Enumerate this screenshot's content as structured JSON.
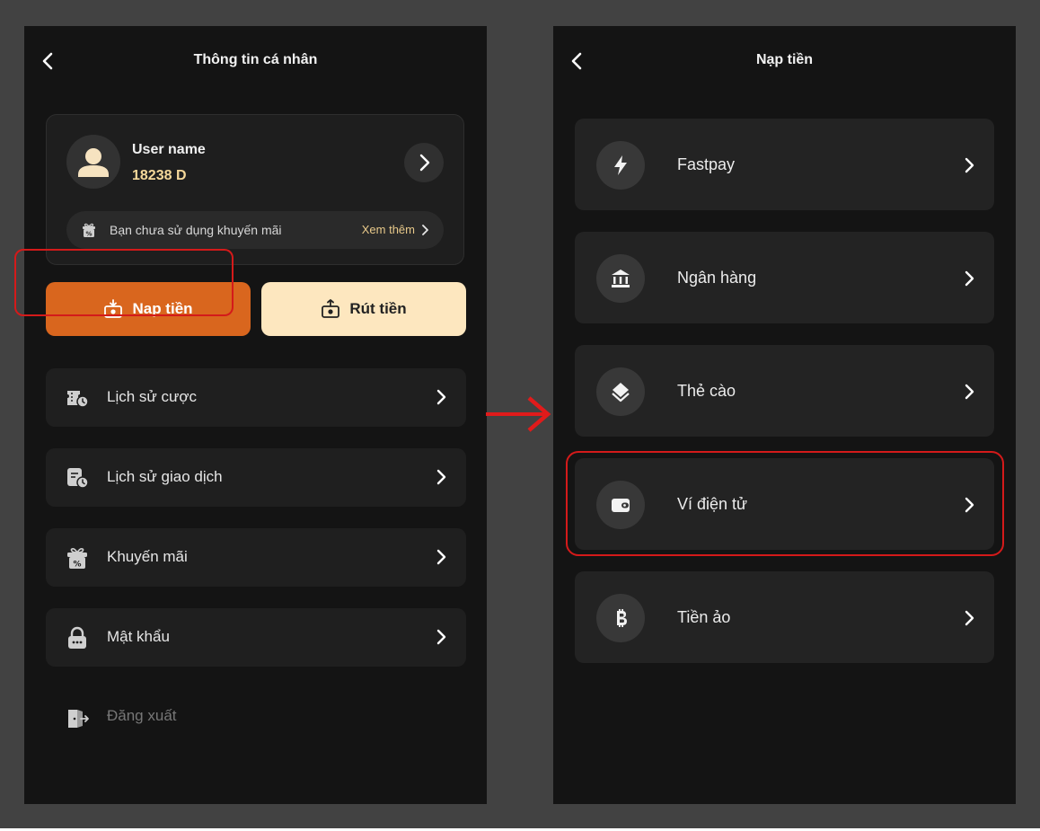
{
  "left_screen": {
    "title": "Thông tin cá nhân",
    "profile": {
      "username": "User name",
      "balance": "18238 D"
    },
    "promo": {
      "text": "Bạn chưa sử dụng khuyến mãi",
      "more": "Xem thêm"
    },
    "actions": {
      "deposit": "Nạp tiền",
      "withdraw": "Rút tiền"
    },
    "menu": [
      {
        "label": "Lịch sử cược",
        "icon": "ticket-clock-icon"
      },
      {
        "label": "Lịch sử giao dịch",
        "icon": "receipt-clock-icon"
      },
      {
        "label": "Khuyến mãi",
        "icon": "gift-percent-icon"
      },
      {
        "label": "Mật khẩu",
        "icon": "lock-icon"
      }
    ],
    "logout": "Đăng xuất"
  },
  "right_screen": {
    "title": "Nạp tiền",
    "methods": [
      {
        "label": "Fastpay",
        "icon": "lightning-icon"
      },
      {
        "label": "Ngân hàng",
        "icon": "bank-icon"
      },
      {
        "label": "Thẻ cào",
        "icon": "card-stack-icon"
      },
      {
        "label": "Ví điện tử",
        "icon": "wallet-icon"
      },
      {
        "label": "Tiền ảo",
        "icon": "bitcoin-icon"
      }
    ]
  },
  "colors": {
    "accent_orange": "#d9661e",
    "accent_cream": "#fde7bf",
    "balance_gold": "#f5d89a",
    "highlight_red": "#d41a1a"
  }
}
